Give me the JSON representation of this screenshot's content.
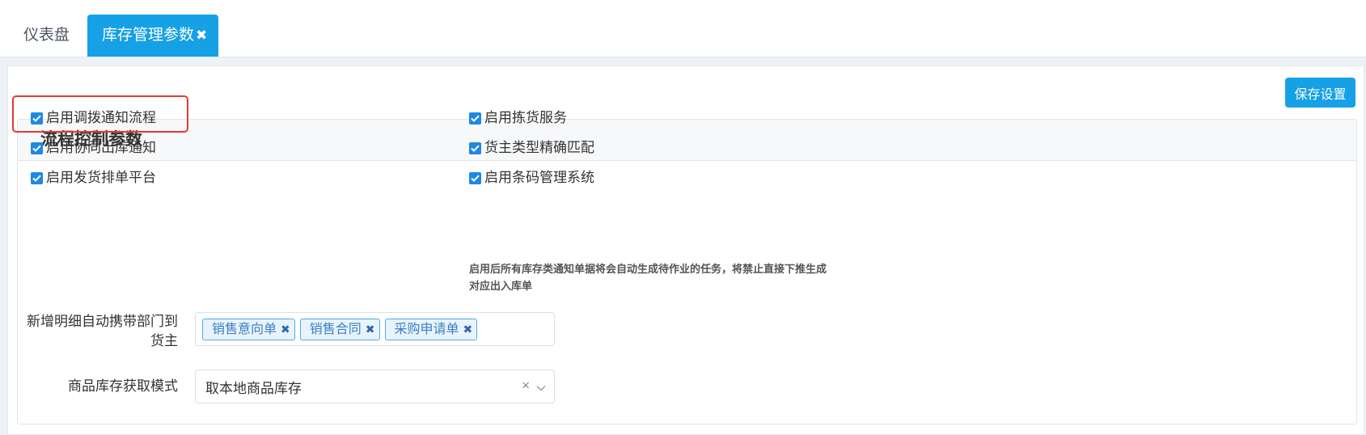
{
  "tabs": [
    {
      "label": "仪表盘"
    },
    {
      "label": "库存管理参数",
      "close": "✖"
    }
  ],
  "toolbar": {
    "save_label": "保存设置"
  },
  "panel": {
    "title": "流程控制参数",
    "checkboxes": [
      {
        "label": "启用调拨通知流程",
        "checked": true
      },
      {
        "label": "启用协同出库通知",
        "checked": true
      },
      {
        "label": "启用发货排单平台",
        "checked": true
      },
      {
        "label": "启用拣货服务",
        "checked": true
      },
      {
        "label": "货主类型精确匹配",
        "checked": true
      },
      {
        "label": "启用条码管理系统",
        "checked": true
      }
    ],
    "hint_line1": "启用后所有库存类通知单据将会自动生成待作业的任务，将禁止直接下推生成",
    "hint_line2": "对应出入库单"
  },
  "form": {
    "dept_label_line1": "新增明细自动携带部门到",
    "dept_label_line2": "货主",
    "tags": [
      {
        "label": "销售意向单",
        "close": "✖"
      },
      {
        "label": "销售合同",
        "close": "✖"
      },
      {
        "label": "采购申请单",
        "close": "✖"
      }
    ],
    "stock_mode_label": "商品库存获取模式",
    "stock_mode_value": "取本地商品库存",
    "clear_glyph": "×"
  },
  "colors": {
    "accent": "#16a0e5",
    "checkbox": "#1e88e5",
    "highlight": "#e53935",
    "tag_border": "#56a8e6"
  }
}
